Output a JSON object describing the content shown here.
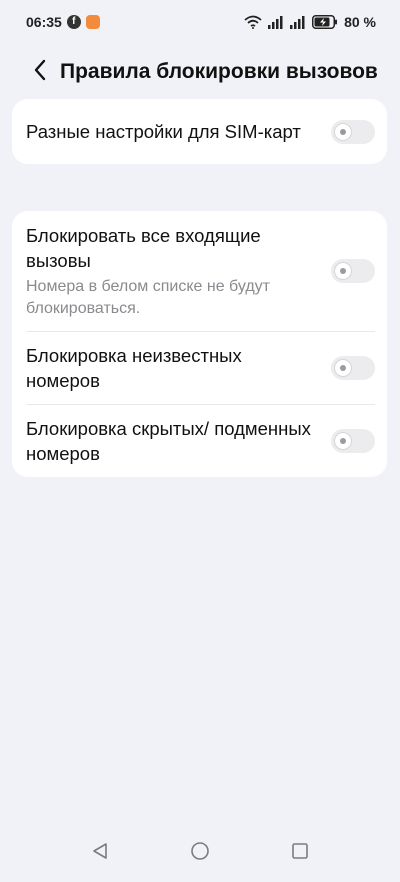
{
  "status_bar": {
    "time": "06:35",
    "fb_glyph": "f",
    "battery": "80 %"
  },
  "header": {
    "title": "Правила блокировки вызовов"
  },
  "sim_card": {
    "label": "Разные настройки для SIM-карт",
    "enabled": false
  },
  "block_settings": [
    {
      "label": "Блокировать все входящие вызовы",
      "description": "Номера в белом списке не будут блокироваться.",
      "enabled": false
    },
    {
      "label": "Блокировка неизвестных номеров",
      "enabled": false
    },
    {
      "label": "Блокировка скрытых/ подменных номеров",
      "enabled": false
    }
  ],
  "icons": {
    "status_left": [
      "facebook-icon",
      "app-notification-icon"
    ],
    "status_right": [
      "wifi-icon",
      "signal-sim1-icon",
      "signal-sim2-icon",
      "battery-charging-icon"
    ],
    "nav": [
      "back-triangle-icon",
      "home-circle-icon",
      "recents-square-icon"
    ]
  }
}
